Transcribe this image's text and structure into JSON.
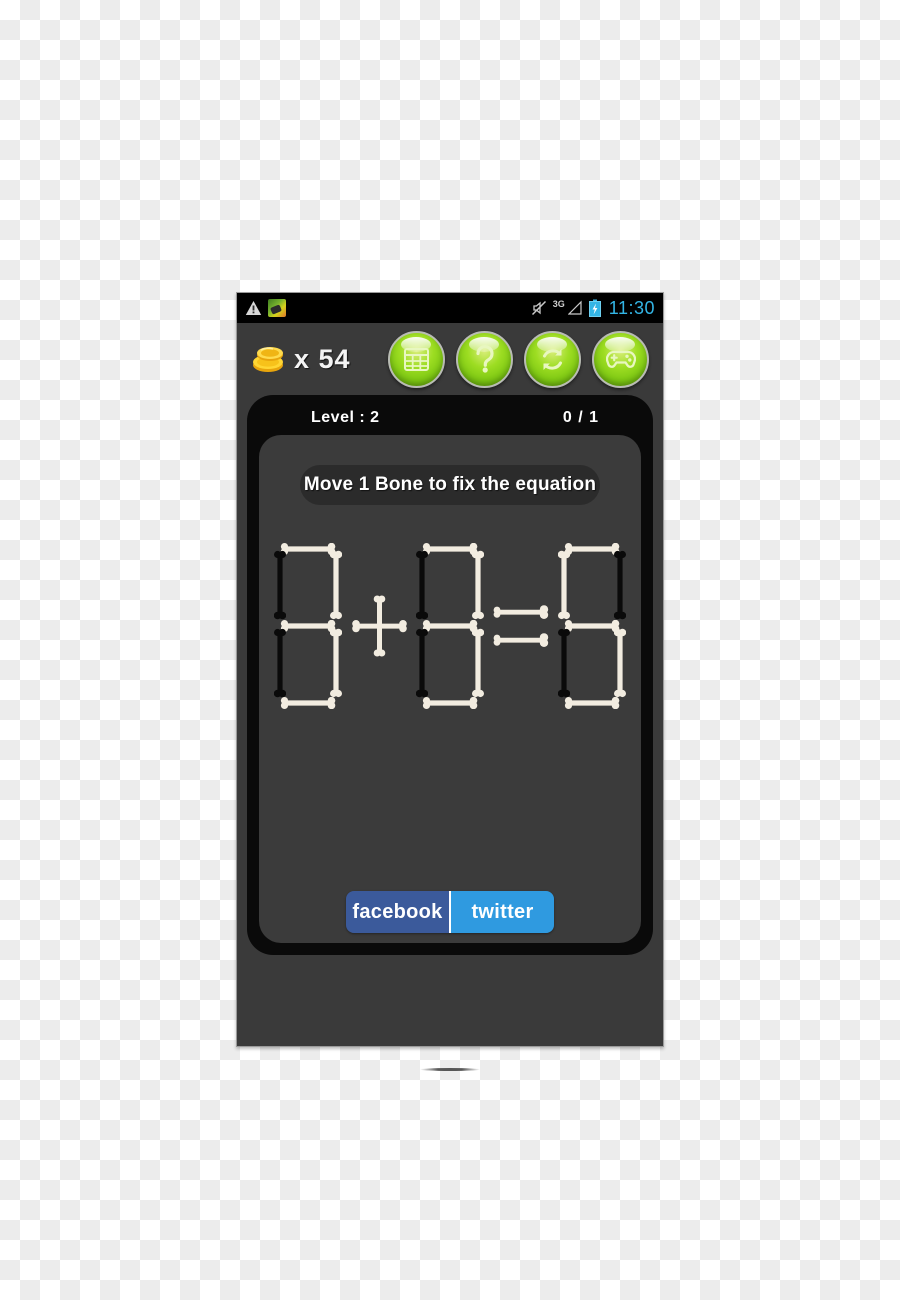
{
  "statusbar": {
    "icons_left": [
      "warning-triangle-icon",
      "app-notification-icon"
    ],
    "mute_icon": "vibrate-mute-icon",
    "network_label": "3G",
    "signal_icon": "signal-triangle-icon",
    "battery_icon": "battery-charging-icon",
    "clock": "11:30",
    "clock_color": "#33b5e5",
    "background": "#000000"
  },
  "topbar": {
    "coin_icon": "gold-coin-stack-icon",
    "coin_count_label": "x 54",
    "buttons": [
      {
        "name": "levels-button",
        "icon": "grid-icon"
      },
      {
        "name": "hint-button",
        "icon": "question-mark-icon"
      },
      {
        "name": "restart-button",
        "icon": "refresh-icon"
      },
      {
        "name": "more-games-button",
        "icon": "gamepad-icon"
      }
    ],
    "button_color": "#9ddd22",
    "background": "#3a3a3a"
  },
  "game": {
    "level_label": "Level : 2",
    "score_label": "0 / 1",
    "hint_text": "Move 1 Bone to fix the equation",
    "panel_color": "#3b3b3b",
    "frame_color": "#0a0a0a",
    "bone_color": "#f2ece0",
    "dark_bone_color": "#0a0a0a"
  },
  "equation": {
    "expression": "8 + 8 = 8",
    "terms": [
      {
        "type": "digit",
        "value": "8",
        "name": "digit-left",
        "segments": {
          "top": "light",
          "top_left": "dark",
          "top_right": "light",
          "middle": "light",
          "bottom_left": "dark",
          "bottom_right": "light",
          "bottom": "light"
        }
      },
      {
        "type": "operator",
        "value": "+",
        "name": "plus-operator"
      },
      {
        "type": "digit",
        "value": "8",
        "name": "digit-middle",
        "segments": {
          "top": "light",
          "top_left": "dark",
          "top_right": "light",
          "middle": "light",
          "bottom_left": "dark",
          "bottom_right": "light",
          "bottom": "light"
        }
      },
      {
        "type": "operator",
        "value": "=",
        "name": "equals-operator"
      },
      {
        "type": "digit",
        "value": "8",
        "name": "digit-result",
        "segments": {
          "top": "light",
          "top_left": "light",
          "top_right": "dark",
          "middle": "light",
          "bottom_left": "dark",
          "bottom_right": "light",
          "bottom": "light"
        }
      }
    ]
  },
  "social": {
    "facebook_label": "facebook",
    "facebook_color": "#3b5a9b",
    "twitter_label": "twitter",
    "twitter_color": "#2f9ae0"
  }
}
